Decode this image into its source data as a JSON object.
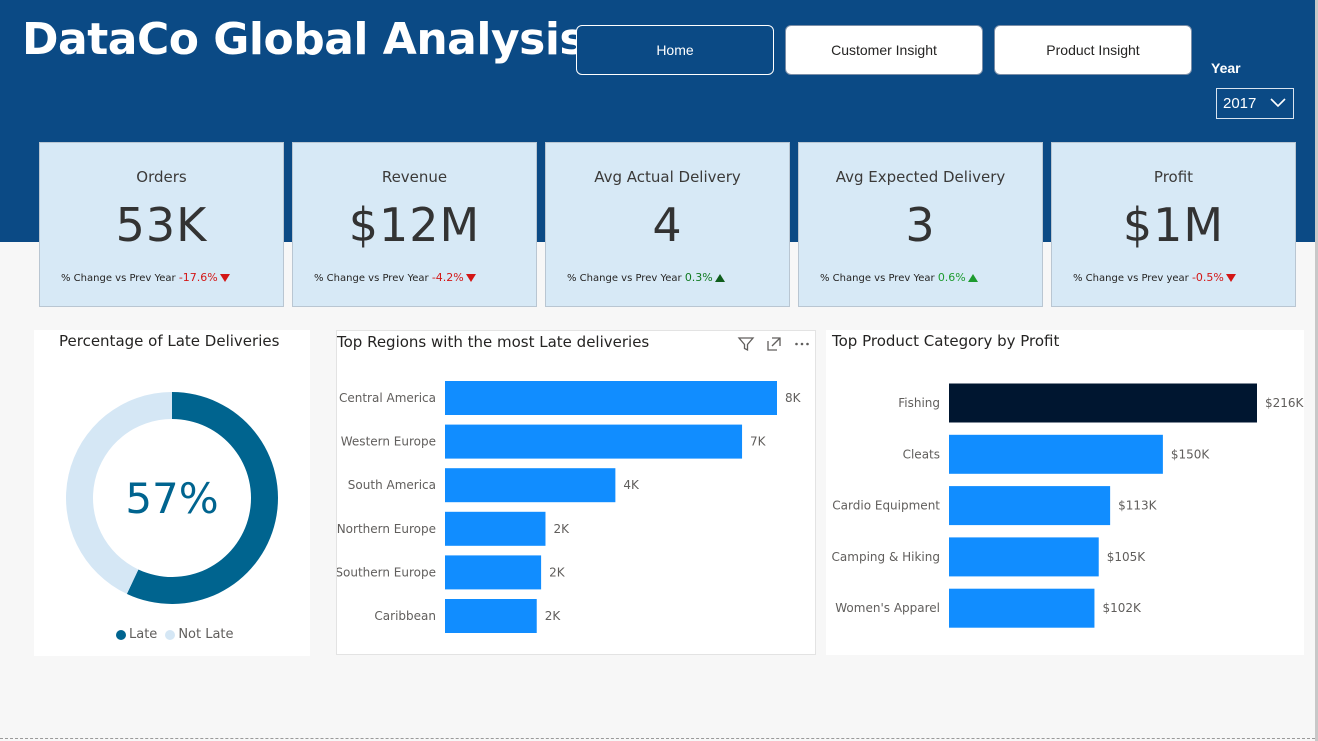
{
  "header": {
    "title": "DataCo Global Analysis",
    "nav": [
      "Home",
      "Customer Insight",
      "Product Insight"
    ],
    "year_label": "Year",
    "year_value": "2017",
    "band_color": "#0b4a85"
  },
  "kpis": [
    {
      "title": "Orders",
      "value": "53K",
      "change_label": "% Change vs Prev Year",
      "change": "-17.6%",
      "direction": "down"
    },
    {
      "title": "Revenue",
      "value": "$12M",
      "change_label": "% Change vs Prev Year",
      "change": "-4.2%",
      "direction": "down"
    },
    {
      "title": "Avg Actual Delivery",
      "value": "4",
      "change_label": "% Change vs Prev Year",
      "change": "0.3%",
      "direction": "up"
    },
    {
      "title": "Avg Expected Delivery",
      "value": "3",
      "change_label": "% Change vs Prev Year",
      "change": "0.6%",
      "direction": "up"
    },
    {
      "title": "Profit",
      "value": "$1M",
      "change_label": "% Change vs Prev year",
      "change": "-0.5%",
      "direction": "down"
    }
  ],
  "colors": {
    "late": "#00648f",
    "not_late": "#d5e7f5",
    "bar": "#118dff",
    "bar_highlight": "#001630",
    "negative": "#d31616",
    "positive": "#1d9b2f"
  },
  "chart_data": [
    {
      "type": "pie",
      "title": "Percentage of Late Deliveries",
      "center_label": "57%",
      "categories": [
        "Late",
        "Not Late"
      ],
      "values": [
        57,
        43
      ],
      "legend": "bottom"
    },
    {
      "type": "bar",
      "orientation": "horizontal",
      "title": "Top Regions with the most Late deliveries",
      "categories": [
        "Central America",
        "Western Europe",
        "South America",
        "Northern Europe",
        "Southern Europe",
        "Caribbean"
      ],
      "values": [
        7.6,
        6.8,
        3.9,
        2.3,
        2.2,
        2.1
      ],
      "data_labels": [
        "8K",
        "7K",
        "4K",
        "2K",
        "2K",
        "2K"
      ],
      "xlim": [
        0,
        7.6
      ]
    },
    {
      "type": "bar",
      "orientation": "horizontal",
      "title": "Top Product Category by Profit",
      "categories": [
        "Fishing",
        "Cleats",
        "Cardio Equipment",
        "Camping & Hiking",
        "Women's Apparel"
      ],
      "values": [
        216,
        150,
        113,
        105,
        102
      ],
      "data_labels": [
        "$216K",
        "$150K",
        "$113K",
        "$105K",
        "$102K"
      ],
      "highlight": "Fishing",
      "xlim": [
        0,
        216
      ]
    }
  ]
}
